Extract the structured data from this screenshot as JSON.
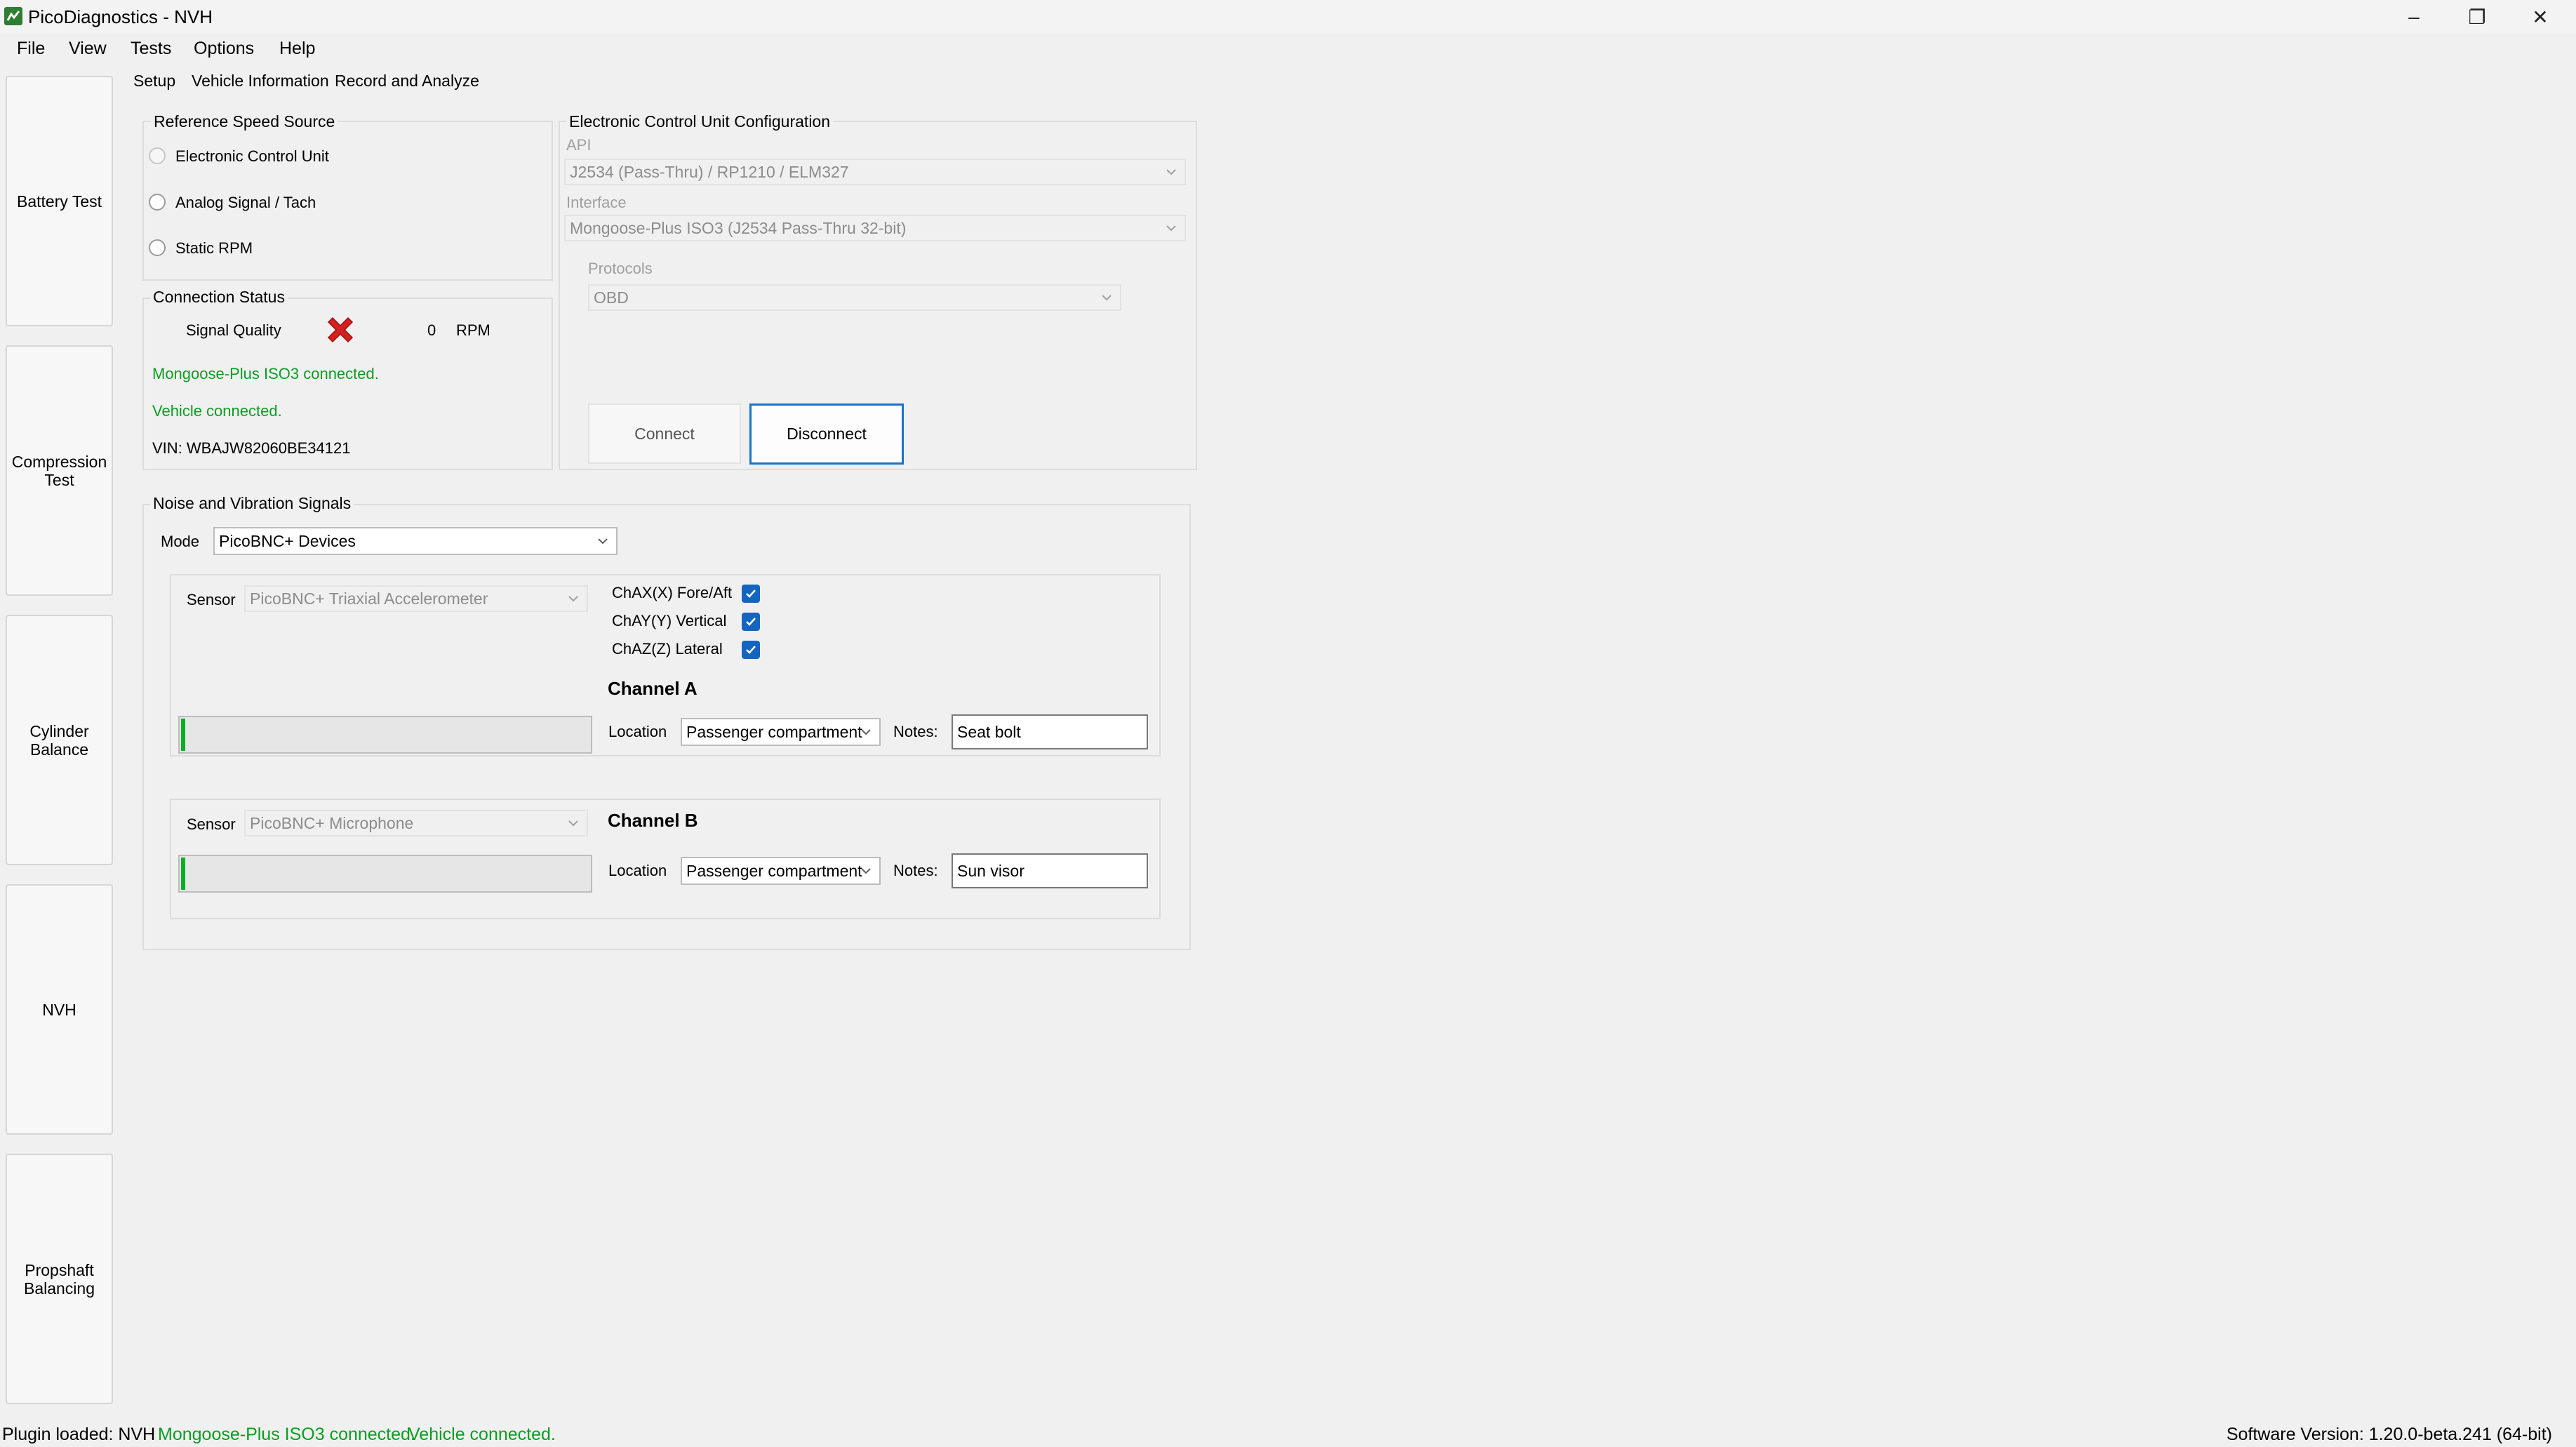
{
  "window": {
    "title": "PicoDiagnostics - NVH",
    "minimize": "–",
    "maximize": "❐",
    "close": "✕"
  },
  "menu": [
    "File",
    "View",
    "Tests",
    "Options",
    "Help"
  ],
  "tabs": [
    "Setup",
    "Vehicle Information",
    "Record and Analyze"
  ],
  "nav": [
    "Battery Test",
    "Compression Test",
    "Cylinder Balance",
    "NVH",
    "Propshaft Balancing"
  ],
  "reference_speed": {
    "title": "Reference Speed Source",
    "options": [
      "Electronic Control Unit",
      "Analog Signal / Tach",
      "Static RPM"
    ]
  },
  "connection": {
    "title": "Connection Status",
    "signal_quality_label": "Signal Quality",
    "rpm_value": "0",
    "rpm_unit": "RPM",
    "msg1": "Mongoose-Plus ISO3 connected.",
    "msg2": "Vehicle connected.",
    "vin": "VIN: WBAJW82060BE34121"
  },
  "ecu": {
    "title": "Electronic Control Unit Configuration",
    "api_label": "API",
    "api_value": "J2534 (Pass-Thru) / RP1210 / ELM327",
    "interface_label": "Interface",
    "interface_value": "Mongoose-Plus ISO3 (J2534 Pass-Thru 32-bit)",
    "protocols_label": "Protocols",
    "protocols_value": "OBD",
    "connect": "Connect",
    "disconnect": "Disconnect"
  },
  "nvs": {
    "title": "Noise and Vibration Signals",
    "mode_label": "Mode",
    "mode_value": "PicoBNC+ Devices",
    "channel_a": {
      "sensor_label": "Sensor",
      "sensor_value": "PicoBNC+ Triaxial Accelerometer",
      "axes": [
        "ChAX(X) Fore/Aft",
        "ChAY(Y) Vertical",
        "ChAZ(Z) Lateral"
      ],
      "title": "Channel A",
      "location_label": "Location",
      "location_value": "Passenger compartment",
      "notes_label": "Notes:",
      "notes_value": "Seat bolt",
      "level": 0.01
    },
    "channel_b": {
      "sensor_label": "Sensor",
      "sensor_value": "PicoBNC+ Microphone",
      "title": "Channel B",
      "location_label": "Location",
      "location_value": "Passenger compartment",
      "notes_label": "Notes:",
      "notes_value": "Sun visor",
      "level": 0.01
    }
  },
  "statusbar": {
    "plugin": "Plugin loaded: NVH",
    "msg1": "Mongoose-Plus ISO3 connected.",
    "msg2": "Vehicle connected.",
    "version": "Software Version: 1.20.0-beta.241 (64-bit)"
  },
  "colors": {
    "accent": "#1a73c7",
    "status_green": "#0a9e22",
    "error_red": "#d32020",
    "checkbox_blue": "#1565c0"
  }
}
